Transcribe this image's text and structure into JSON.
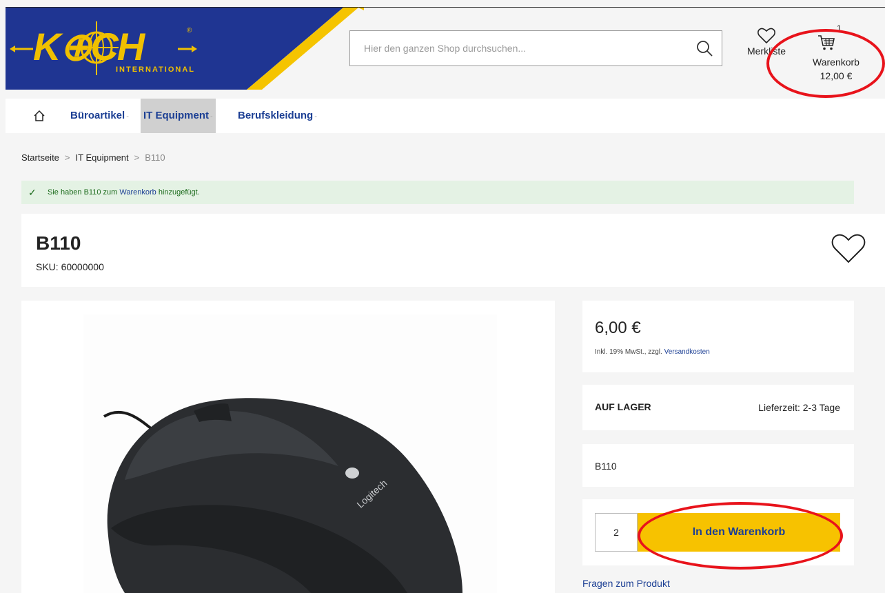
{
  "header": {
    "logo_text": "K⊕CH",
    "logo_sub": "INTERNATIONAL",
    "logo_reg": "®",
    "search_placeholder": "Hier den ganzen Shop durchsuchen...",
    "wishlist_label": "Merkliste",
    "cart_count": "1",
    "cart_label": "Warenkorb",
    "cart_total": "12,00 €"
  },
  "nav": {
    "items": [
      {
        "label": "Büroartikel",
        "caret": "-"
      },
      {
        "label": "IT Equipment",
        "caret": "-"
      },
      {
        "label": "Berufskleidung",
        "caret": "-"
      }
    ]
  },
  "breadcrumb": {
    "home": "Startseite",
    "sep1": ">",
    "category": "IT Equipment",
    "sep2": ">",
    "current": "B110"
  },
  "message": {
    "check": "✓",
    "prefix": "Sie haben B110 zum ",
    "link": "Warenkorb",
    "suffix": " hinzugefügt."
  },
  "product": {
    "title": "B110",
    "sku": "SKU: 60000000",
    "price": "6,00 €",
    "tax_prefix": "Inkl. 19% MwSt., zzgl. ",
    "tax_link": "Versandkosten",
    "stock": "AUF LAGER",
    "delivery": "Lieferzeit: 2-3 Tage",
    "variant": "B110",
    "qty": "2",
    "add_to_cart": "In den Warenkorb",
    "questions": "Fragen zum Produkt",
    "image_brand": "Logitech"
  },
  "colors": {
    "brand_blue": "#1c3f94",
    "brand_yellow": "#f7c200",
    "annotation_red": "#e8131b"
  }
}
